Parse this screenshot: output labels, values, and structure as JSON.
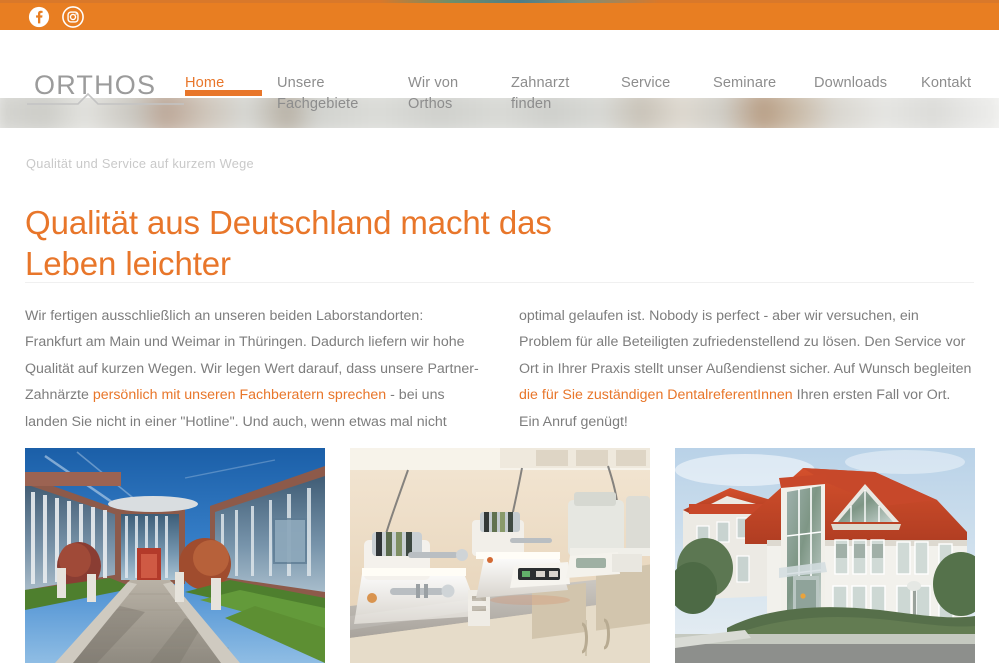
{
  "site": {
    "brand": "ORTHOS"
  },
  "social_bar": {
    "background": "#e87e22",
    "icons": [
      {
        "name": "facebook-icon",
        "label": "Facebook"
      },
      {
        "name": "instagram-icon",
        "label": "Instagram"
      }
    ]
  },
  "nav": {
    "active_color": "#e8762a",
    "inactive_color": "#8d8d8d",
    "items": [
      {
        "label": "Home",
        "active": true
      },
      {
        "label": "Unsere\nFachgebiete",
        "active": false
      },
      {
        "label": "Wir von\nOrthos",
        "active": false
      },
      {
        "label": "Zahnarzt\nfinden",
        "active": false
      },
      {
        "label": "Service",
        "active": false
      },
      {
        "label": "Seminare",
        "active": false
      },
      {
        "label": "Downloads",
        "active": false
      },
      {
        "label": "Kontakt",
        "active": false
      }
    ]
  },
  "hero": {
    "description": "blurred light interior photo banner strip"
  },
  "main": {
    "eyebrow": "Qualität und Service auf kurzem Wege",
    "headline": "Qualität aus Deutschland macht das Leben leichter",
    "headline_color": "#e8762a",
    "body_left_part1": "Wir fertigen ausschließlich an unseren beiden Laborstandorten: Frankfurt am Main und Weimar in Thüringen. Dadurch liefern wir hohe Qualität auf kurzen Wegen. Wir legen Wert darauf, dass unsere Partner-Zahnärzte ",
    "body_left_link": "persönlich mit unseren Fachberatern sprechen",
    "body_left_part2": " - bei uns landen Sie nicht in einer \"Hotline\". Und auch, wenn etwas mal nicht",
    "body_right_part1": "optimal gelaufen ist. Nobody is perfect - aber wir versuchen, ein Problem für alle Beteiligten zufriedenstellend zu lösen. Den Service vor Ort in Ihrer Praxis stellt unser Außendienst sicher. Auf Wunsch begleiten ",
    "body_right_link": "die für Sie zuständigen DentalreferentInnen",
    "body_right_part2": " Ihren ersten Fall vor Ort. Ein Anruf genügt!"
  },
  "photos": [
    {
      "name": "photo-office-campus",
      "alt": "Modernes Bürogebäude mit Glasfassade und Grünanlage"
    },
    {
      "name": "photo-dental-lab-equipment",
      "alt": "Dentallabor-Geräte auf einer Arbeitsplatte"
    },
    {
      "name": "photo-white-building",
      "alt": "Weißes Gebäude mit rotem Ziegeldach"
    }
  ]
}
